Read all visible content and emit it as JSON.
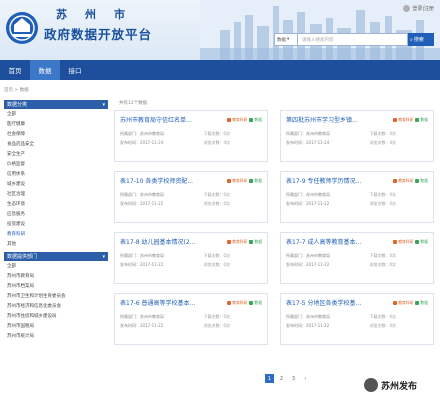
{
  "header": {
    "city": "苏州市",
    "title": "政府数据开放平台",
    "login_label": "登录|注册",
    "search": {
      "select_label": "数据",
      "placeholder": "请输入搜索内容",
      "button_label": "搜索"
    }
  },
  "nav": {
    "tabs": [
      {
        "label": "首页"
      },
      {
        "label": "数据"
      },
      {
        "label": "接口"
      }
    ]
  },
  "breadcrumb": "首页 > 数据",
  "sidebar": {
    "category_header": "数据分类",
    "categories": [
      {
        "label": "全部"
      },
      {
        "label": "医疗健康"
      },
      {
        "label": "社会保障"
      },
      {
        "label": "食品药品安全"
      },
      {
        "label": "安全生产"
      },
      {
        "label": "价格监督"
      },
      {
        "label": "信用体系"
      },
      {
        "label": "城乡建设"
      },
      {
        "label": "社区治理"
      },
      {
        "label": "生态环境"
      },
      {
        "label": "应急服务"
      },
      {
        "label": "投资建设"
      },
      {
        "label": "教育科研"
      },
      {
        "label": "其他"
      }
    ],
    "dept_header": "数据提供部门",
    "departments": [
      {
        "label": "全部"
      },
      {
        "label": "苏州市教育局"
      },
      {
        "label": "苏州市档案局"
      },
      {
        "label": "苏州市卫生和计划生育委员会"
      },
      {
        "label": "苏州市经济和信息化委员会"
      },
      {
        "label": "苏州市住房和城乡建设局"
      },
      {
        "label": "苏州市国税局"
      },
      {
        "label": "苏州市统计局"
      }
    ]
  },
  "main": {
    "count_text": "共有12个数据",
    "cards": [
      {
        "title": "苏州市教育局守信红名单...",
        "tag1": "教育科研",
        "tag2": "数据",
        "dept_label": "所属部门：苏州市教育局",
        "date_label": "发布时间：2017-11-24",
        "downloads": "下载次数：0次",
        "views": "浏览次数：4次"
      },
      {
        "title": "第四批苏州市学习型乡镇...",
        "tag1": "教育科研",
        "tag2": "数据",
        "dept_label": "所属部门：苏州市教育局",
        "date_label": "发布时间：2017-11-24",
        "downloads": "下载次数：0次",
        "views": "浏览次数：4次"
      },
      {
        "title": "表17-10 各类学校师资配...",
        "tag1": "教育科研",
        "tag2": "数据",
        "dept_label": "所属部门：苏州市教育局",
        "date_label": "发布时间：2017-11-22",
        "downloads": "下载次数：0次",
        "views": "浏览次数：0次"
      },
      {
        "title": "表17-9 专任教师学历情况...",
        "tag1": "教育科研",
        "tag2": "数据",
        "dept_label": "所属部门：苏州市教育局",
        "date_label": "发布时间：2017-11-22",
        "downloads": "下载次数：0次",
        "views": "浏览次数：0次"
      },
      {
        "title": "表17-8 幼儿园基本情况(2...",
        "tag1": "教育科研",
        "tag2": "数据",
        "dept_label": "所属部门：苏州市教育局",
        "date_label": "发布时间：2017-11-22",
        "downloads": "下载次数：0次",
        "views": "浏览次数：0次"
      },
      {
        "title": "表17-7 成人高等教育基本...",
        "tag1": "教育科研",
        "tag2": "数据",
        "dept_label": "所属部门：苏州市教育局",
        "date_label": "发布时间：2017-11-22",
        "downloads": "下载次数：0次",
        "views": "浏览次数：0次"
      },
      {
        "title": "表17-6 普通高等学校基本...",
        "tag1": "教育科研",
        "tag2": "数据",
        "dept_label": "所属部门：苏州市教育局",
        "date_label": "发布时间：2017-11-22",
        "downloads": "下载次数：0次",
        "views": "浏览次数：0次"
      },
      {
        "title": "表17-5 分地区各类学校基...",
        "tag1": "教育科研",
        "tag2": "数据",
        "dept_label": "所属部门：苏州市教育局",
        "date_label": "发布时间：2017-11-22",
        "downloads": "下载次数：0次",
        "views": "浏览次数：0次"
      }
    ]
  },
  "pagination": {
    "pages": [
      "1",
      "2",
      "3"
    ],
    "next": "›"
  },
  "watermark": {
    "text": "苏州发布"
  }
}
